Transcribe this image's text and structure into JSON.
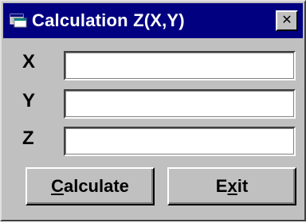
{
  "window": {
    "title": "Calculation Z(X,Y)",
    "close_glyph": "✕",
    "icon": "app-window-icon"
  },
  "fields": [
    {
      "label": "X",
      "value": ""
    },
    {
      "label": "Y",
      "value": ""
    },
    {
      "label": "Z",
      "value": ""
    }
  ],
  "buttons": {
    "calculate": {
      "mnemonic": "C",
      "rest": "alculate"
    },
    "exit": {
      "pre": "E",
      "mnemonic": "x",
      "rest": "it"
    }
  },
  "colors": {
    "titlebar": "#000080",
    "face": "#c0c0c0"
  }
}
